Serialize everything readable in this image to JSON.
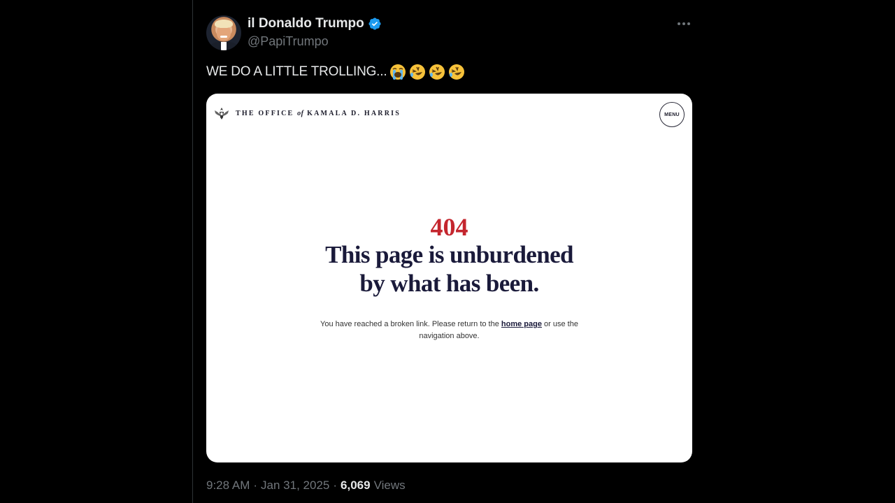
{
  "author": {
    "display_name": "il Donaldo Trumpo",
    "handle": "@PapiTrumpo",
    "verified": true
  },
  "tweet": {
    "text": "WE DO A LITTLE TROLLING...",
    "emojis": [
      "loudly-crying-face",
      "rolling-on-floor-laughing",
      "rolling-on-floor-laughing",
      "rolling-on-floor-laughing"
    ]
  },
  "media": {
    "site_name_part1": "THE OFFICE",
    "site_name_of": "of",
    "site_name_part2": "KAMALA D. HARRIS",
    "menu_label": "MENU",
    "error_code": "404",
    "error_title_line1": "This page is unburdened",
    "error_title_line2": "by what has been.",
    "body_before_link": "You have reached a broken link. Please return to the",
    "link_text": "home page",
    "body_after_link": "or use the",
    "body_line2": "navigation above."
  },
  "meta": {
    "time": "9:28 AM",
    "separator": "·",
    "date": "Jan 31, 2025",
    "views_count": "6,069",
    "views_label": "Views"
  },
  "colors": {
    "background": "#000000",
    "text_primary": "#e7e9ea",
    "text_secondary": "#71767b",
    "verified_blue": "#1d9bf0",
    "error_red": "#c4262e",
    "title_navy": "#1a1a3a"
  }
}
